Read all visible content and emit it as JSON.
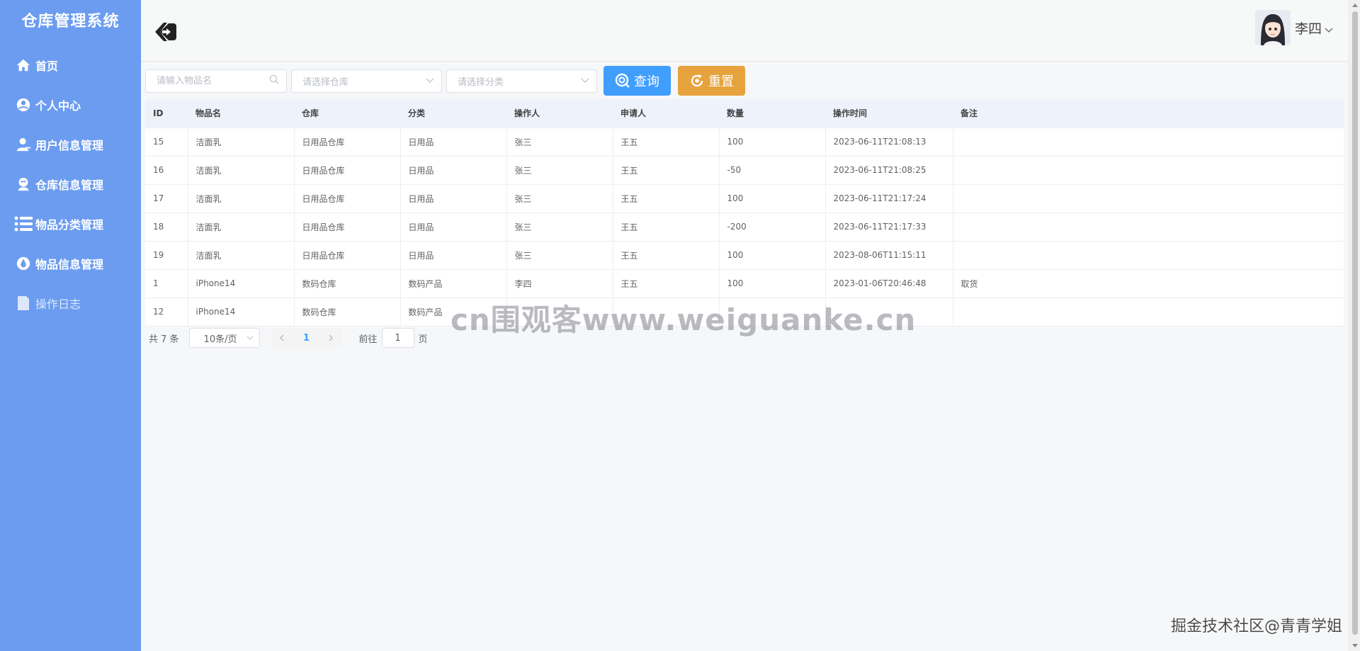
{
  "sidebar": {
    "brand": "仓库管理系统",
    "items": [
      {
        "label": "首页",
        "icon": "home-icon"
      },
      {
        "label": "个人中心",
        "icon": "user-circle-icon"
      },
      {
        "label": "用户信息管理",
        "icon": "user-manage-icon"
      },
      {
        "label": "仓库信息管理",
        "icon": "warehouse-icon"
      },
      {
        "label": "物品分类管理",
        "icon": "list-icon"
      },
      {
        "label": "物品信息管理",
        "icon": "drop-icon"
      },
      {
        "label": "操作日志",
        "icon": "log-icon",
        "active": true
      }
    ],
    "bg_color": "#6b9cf0"
  },
  "header": {
    "username": "李四",
    "back_icon": "back-arrow-icon"
  },
  "search": {
    "item_placeholder": "请输入物品名",
    "warehouse_placeholder": "请选择仓库",
    "category_placeholder": "请选择分类",
    "query_label": "查询",
    "reset_label": "重置",
    "query_color": "#409eff",
    "reset_color": "#e6a23c"
  },
  "table": {
    "columns": [
      "ID",
      "物品名",
      "仓库",
      "分类",
      "操作人",
      "申请人",
      "数量",
      "操作时间",
      "备注"
    ],
    "rows": [
      [
        "15",
        "洁面乳",
        "日用品仓库",
        "日用品",
        "张三",
        "王五",
        "100",
        "2023-06-11T21:08:13",
        ""
      ],
      [
        "16",
        "洁面乳",
        "日用品仓库",
        "日用品",
        "张三",
        "王五",
        "-50",
        "2023-06-11T21:08:25",
        ""
      ],
      [
        "17",
        "洁面乳",
        "日用品仓库",
        "日用品",
        "张三",
        "王五",
        "100",
        "2023-06-11T21:17:24",
        ""
      ],
      [
        "18",
        "洁面乳",
        "日用品仓库",
        "日用品",
        "张三",
        "王五",
        "-200",
        "2023-06-11T21:17:33",
        ""
      ],
      [
        "19",
        "洁面乳",
        "日用品仓库",
        "日用品",
        "张三",
        "王五",
        "100",
        "2023-08-06T11:15:11",
        ""
      ],
      [
        "1",
        "iPhone14",
        "数码仓库",
        "数码产品",
        "李四",
        "王五",
        "100",
        "2023-01-06T20:46:48",
        "取货"
      ],
      [
        "12",
        "iPhone14",
        "数码仓库",
        "数码产品",
        "",
        "",
        "",
        "",
        ""
      ]
    ]
  },
  "pagination": {
    "total": "共 7 条",
    "page_size": "10条/页",
    "current_page": "1",
    "goto_label": "前往",
    "goto_value": "1",
    "page_suffix": "页"
  },
  "watermarks": {
    "center": "cn围观客www.weiguanke.cn",
    "corner": "掘金技术社区@青青学姐"
  }
}
